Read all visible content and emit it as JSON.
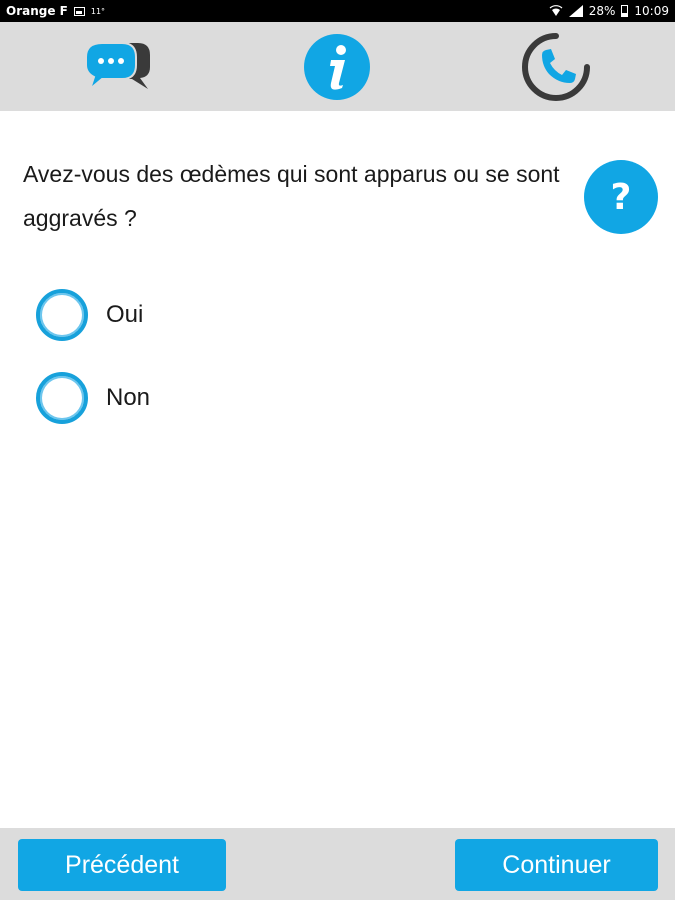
{
  "status_bar": {
    "carrier": "Orange F",
    "temperature": "11°",
    "battery": "28%",
    "time": "10:09"
  },
  "toolbar": {
    "icons": [
      "chat-bubbles-icon",
      "info-icon",
      "phone-icon"
    ]
  },
  "question": {
    "text": "Avez-vous des œdèmes qui sont apparus ou se sont aggravés ?",
    "help_label": "?"
  },
  "options": [
    {
      "label": "Oui",
      "selected": false
    },
    {
      "label": "Non",
      "selected": false
    }
  ],
  "navigation": {
    "previous_label": "Précédent",
    "next_label": "Continuer"
  },
  "colors": {
    "accent": "#11a6e4",
    "toolbar_bg": "#dcdcdc",
    "dark_icon": "#3a3a3a"
  }
}
